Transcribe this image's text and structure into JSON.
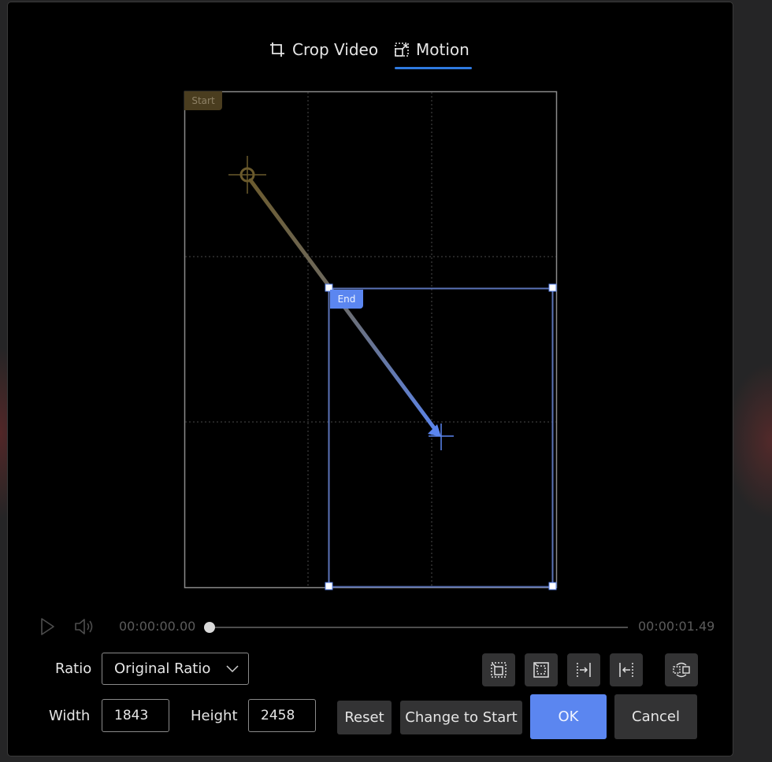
{
  "tabs": [
    {
      "id": "crop",
      "label": "Crop Video",
      "icon": "crop-icon",
      "active": false
    },
    {
      "id": "motion",
      "label": "Motion",
      "icon": "motion-icon",
      "active": true
    }
  ],
  "colors": {
    "accent": "#2f7ae0",
    "end_color": "#5b86f0",
    "start_color": "#6b5a2c",
    "button_bg": "#333334"
  },
  "canvas": {
    "start_label": "Start",
    "end_label": "End"
  },
  "playback": {
    "current_time": "00:00:00.00",
    "end_time": "00:00:01.49",
    "progress": 0,
    "play_icon": "play-icon",
    "volume_icon": "volume-icon"
  },
  "form": {
    "ratio_label": "Ratio",
    "ratio_value": "Original Ratio",
    "width_label": "Width",
    "width_value": "1843",
    "height_label": "Height",
    "height_value": "2458"
  },
  "tools": [
    {
      "name": "fit-crop-icon",
      "title": "Fit"
    },
    {
      "name": "fill-crop-icon",
      "title": "Fill"
    },
    {
      "name": "align-right-icon",
      "title": "Move to right"
    },
    {
      "name": "align-left-icon",
      "title": "Move to left"
    },
    {
      "name": "swap-icon",
      "title": "Swap"
    }
  ],
  "buttons": {
    "reset": "Reset",
    "change_to_start": "Change to Start",
    "ok": "OK",
    "cancel": "Cancel"
  }
}
